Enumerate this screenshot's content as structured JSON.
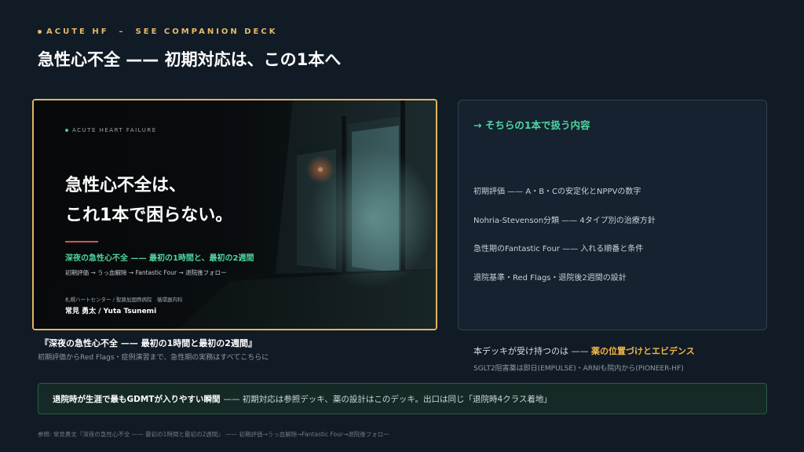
{
  "header": {
    "eyebrow": "ACUTE HF　–　SEE COMPANION DECK",
    "title": "急性心不全 —— 初期対応は、この1本へ"
  },
  "slide": {
    "eyebrow": "ACUTE HEART FAILURE",
    "headline_line1": "急性心不全は、",
    "headline_line2": "これ1本で困らない。",
    "subtitle": "深夜の急性心不全 —— 最初の1時間と、最初の2週間",
    "steps": "初期評価 → うっ血解除 → Fantastic Four → 退院後フォロー",
    "affiliation": "札幌ハートセンター / 聖路加国際病院　循環器内科",
    "author": "常見 勇太 / Yuta Tsunemi"
  },
  "caption": {
    "title": "『深夜の急性心不全 —— 最初の1時間と最初の2週間』",
    "desc": "初期評価からRed Flags・症例演習まで、急性期の実務はすべてこちらに"
  },
  "panel": {
    "heading": "→ そちらの1本で扱う内容",
    "items": [
      "初期評価 —— A・B・Cの安定化とNPPVの数字",
      "Nohria-Stevenson分類 —— 4タイプ別の治療方針",
      "急性期のFantastic Four —— 入れる順番と条件",
      "退院基準・Red Flags・退院後2週間の設計"
    ]
  },
  "support": {
    "prefix": "本デッキが受け持つのは —— ",
    "highlight": "薬の位置づけとエビデンス",
    "sub": "SGLT2阻害薬は即日(EMPULSE)・ARNIも院内から(PIONEER-HF)"
  },
  "banner": {
    "strong": "退院時が生涯で最もGDMTが入りやすい瞬間",
    "rest": "—— 初期対応は参照デッキ、薬の設計はこのデッキ。出口は同じ「退院時4クラス着地」"
  },
  "footnote": "参照: 常見勇太『深夜の急性心不全 —— 最初の1時間と最初の2週間』 —— 初期評価→うっ血解除→Fantastic Four→退院後フォロー",
  "colors": {
    "accent_gold": "#e8b96a",
    "accent_green": "#4fd6a0",
    "background": "#111b25"
  }
}
